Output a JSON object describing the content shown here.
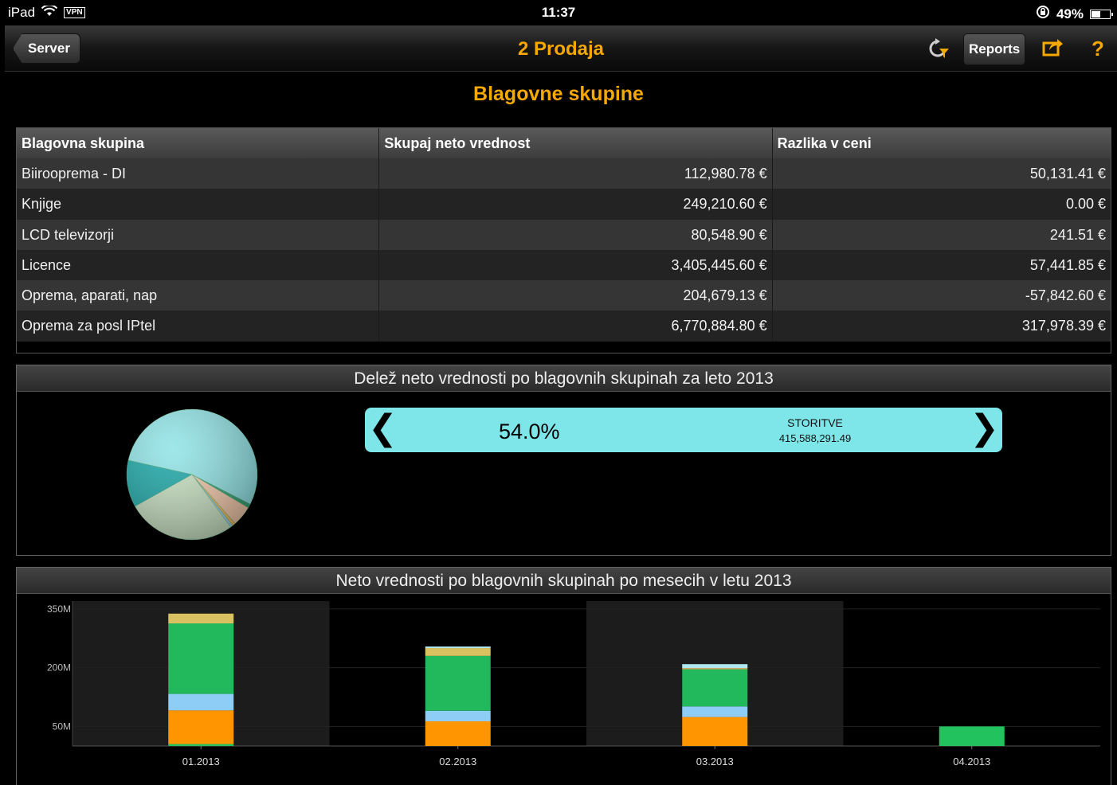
{
  "status": {
    "device": "iPad",
    "vpn": "VPN",
    "time": "11:37",
    "battery": "49%",
    "battery_level": 0.49
  },
  "nav": {
    "back_label": "Server",
    "title": "2 Prodaja",
    "reports_label": "Reports",
    "help": "?"
  },
  "page_title": "Blagovne skupine",
  "table": {
    "headers": [
      "Blagovna skupina",
      "Skupaj neto vrednost",
      "Razlika v ceni"
    ],
    "rows": [
      [
        "Biirooprema - DI",
        "112,980.78 €",
        "50,131.41 €"
      ],
      [
        "Knjige",
        "249,210.60 €",
        "0.00 €"
      ],
      [
        "LCD televizorji",
        "80,548.90 €",
        "241.51 €"
      ],
      [
        "Licence",
        "3,405,445.60 €",
        "57,441.85 €"
      ],
      [
        "Oprema, aparati, nap",
        "204,679.13 €",
        "-57,842.60 €"
      ],
      [
        "Oprema za posl IPtel",
        "6,770,884.80 €",
        "317,978.39 €"
      ]
    ]
  },
  "pie_panel": {
    "title": "Delež neto vrednosti po blagovnih skupinah za leto 2013",
    "selected": {
      "percent": "54.0%",
      "name": "STORITVE",
      "value": "415,588,291.49"
    }
  },
  "bar_panel": {
    "title": "Neto vrednosti po blagovnih skupinah po mesecih v letu 2013"
  },
  "chart_data": [
    {
      "type": "pie",
      "title": "Delež neto vrednosti po blagovnih skupinah za leto 2013",
      "slices": [
        {
          "value": 54.0,
          "color": "#8fe3e6"
        },
        {
          "value": 1.0,
          "color": "#2e9e6e"
        },
        {
          "value": 5.0,
          "color": "#f2c7a8"
        },
        {
          "value": 0.8,
          "color": "#e8b85a"
        },
        {
          "value": 0.6,
          "color": "#9ad0f0"
        },
        {
          "value": 27.0,
          "color": "#c6dfc0"
        },
        {
          "value": 11.6,
          "color": "#1aa6a6"
        }
      ]
    },
    {
      "type": "bar",
      "stacked": true,
      "title": "Neto vrednosti po blagovnih skupinah po mesecih v letu 2013",
      "categories": [
        "01.2013",
        "02.2013",
        "03.2013",
        "04.2013"
      ],
      "y_ticks": [
        {
          "value": 50,
          "label": "50M"
        },
        {
          "value": 200,
          "label": "200M"
        },
        {
          "value": 350,
          "label": "350M"
        }
      ],
      "ylim": [
        0,
        370
      ],
      "series": [
        {
          "color": "#22c25e",
          "values": [
            5,
            0,
            0,
            50
          ]
        },
        {
          "color": "#ff9500",
          "values": [
            86,
            63,
            74,
            0
          ]
        },
        {
          "color": "#8ecdf5",
          "values": [
            42,
            27,
            27,
            0
          ]
        },
        {
          "color": "#22b85c",
          "values": [
            180,
            140,
            95,
            0
          ]
        },
        {
          "color": "#e8b060",
          "values": [
            0,
            0,
            3,
            0
          ]
        },
        {
          "color": "#d9c060",
          "values": [
            25,
            20,
            0,
            0
          ]
        },
        {
          "color": "#b0e8f0",
          "values": [
            0,
            4,
            10,
            0
          ]
        }
      ]
    }
  ]
}
